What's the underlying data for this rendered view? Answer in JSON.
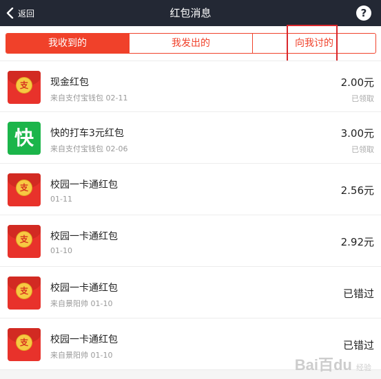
{
  "header": {
    "back_label": "返回",
    "title": "红包消息",
    "help": "?"
  },
  "tabs": [
    {
      "label": "我收到的",
      "active": true
    },
    {
      "label": "我发出的",
      "active": false
    },
    {
      "label": "向我讨的",
      "active": false
    }
  ],
  "items": [
    {
      "title": "现金红包",
      "sub": "来自支付宝钱包 02-11",
      "amount": "2.00元",
      "status": "已领取",
      "icon": "red-envelope-icon"
    },
    {
      "title": "快的打车3元红包",
      "sub": "来自支付宝钱包 02-06",
      "amount": "3.00元",
      "status": "已领取",
      "icon": "kuaidi-icon"
    },
    {
      "title": "校园一卡通红包",
      "sub": "01-11",
      "amount": "2.56元",
      "status": "",
      "icon": "red-envelope-icon"
    },
    {
      "title": "校园一卡通红包",
      "sub": "01-10",
      "amount": "2.92元",
      "status": "",
      "icon": "red-envelope-icon"
    },
    {
      "title": "校园一卡通红包",
      "sub": "来自景阳帅 01-10",
      "amount": "已错过",
      "status": "",
      "icon": "red-envelope-icon"
    },
    {
      "title": "校园一卡通红包",
      "sub": "来自景阳帅 01-10",
      "amount": "已错过",
      "status": "",
      "icon": "red-envelope-icon"
    }
  ],
  "icons": {
    "coin_char": "支",
    "kuai_char": "快"
  },
  "watermark": {
    "main": "Bai",
    "mid": "百",
    "tail": "du",
    "sub": "经验"
  },
  "colors": {
    "accent": "#f0412a",
    "topbar": "#232834"
  }
}
